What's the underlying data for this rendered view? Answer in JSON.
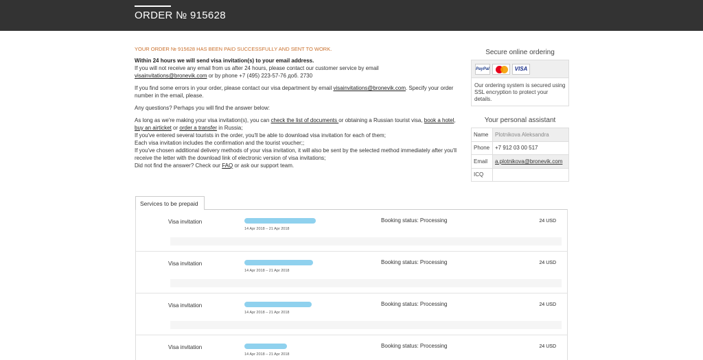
{
  "header": {
    "title": "ORDER № 915628"
  },
  "message": {
    "success": "YOUR ORDER № 915628 HAS BEEN PAID SUCCESSFULLY AND SENT TO WORK.",
    "bold_line": "Within 24 hours we will send visa invitation(s) to your email address.",
    "line1": "If you will not receive any email from us after 24 hours, please contact our customer service by email",
    "email_link": "visainvitations@bronevik.com",
    "line1b": " or by phone +7 (495) 223-57-76 доб. 2730",
    "errors_pre": "If you find some errors in your order, please contact our visa department by email ",
    "errors_link": "visainvitations@bronevik.com",
    "errors_post": ". Specify your order number in the email, please.",
    "questions": "Any questions? Perhaps you will find the answer below:",
    "faq_a": "As long as we're making your visa invitation(s), you can ",
    "faq_link_docs": "check the list of documents ",
    "faq_b": "or obtaining a Russian tourist visa, ",
    "faq_link_hotel": "book a hotel",
    "faq_c": ", ",
    "faq_link_air": "buy an airticket",
    "faq_d": " or ",
    "faq_link_transfer": "order a transfer",
    "faq_e": " in Russia;",
    "faq_line2": "If you've entered several tourists in the order, you'll be able to download visa invitation for each of them;",
    "faq_line3": "Each visa invitation includes the confirmation and the tourist voucher;;",
    "faq_line4": "If you've chosen additional delivery methods of your visa invitation, it will also be sent by the selected method immediately after you'll receive the letter with the download link of electronic version of visa invitations;",
    "faq_line5_a": "Did not find the answer? Check our ",
    "faq_link_faq": "FAQ",
    "faq_line5_b": " or ask our support team."
  },
  "secure": {
    "title": "Secure online ordering",
    "cards": [
      "PayPal",
      "MasterCard",
      "VISA"
    ],
    "note": "Our ordering system is secured using SSL encryption to protect your details."
  },
  "assistant": {
    "title": "Your personal assistant",
    "rows": [
      {
        "key": "Name",
        "value": "Plotnikova Aleksandra"
      },
      {
        "key": "Phone",
        "value": "+7 912 03 00 517"
      },
      {
        "key": "Email",
        "value": "a.plotnikova@bronevik.com"
      },
      {
        "key": "ICQ",
        "value": ""
      }
    ]
  },
  "services": {
    "tab_label": "Services to be prepaid",
    "items": [
      {
        "name": "Visa invitation",
        "dates": "14 Apr 2018 – 21 Apr 2018",
        "status": "Booking status: Processing",
        "price": "24 USD"
      },
      {
        "name": "Visa invitation",
        "dates": "14 Apr 2018 – 21 Apr 2018",
        "status": "Booking status: Processing",
        "price": "24 USD"
      },
      {
        "name": "Visa invitation",
        "dates": "14 Apr 2018 – 21 Apr 2018",
        "status": "Booking status: Processing",
        "price": "24 USD"
      },
      {
        "name": "Visa invitation",
        "dates": "14 Apr 2018 – 21 Apr 2018",
        "status": "Booking status: Processing",
        "price": "24 USD"
      }
    ]
  }
}
